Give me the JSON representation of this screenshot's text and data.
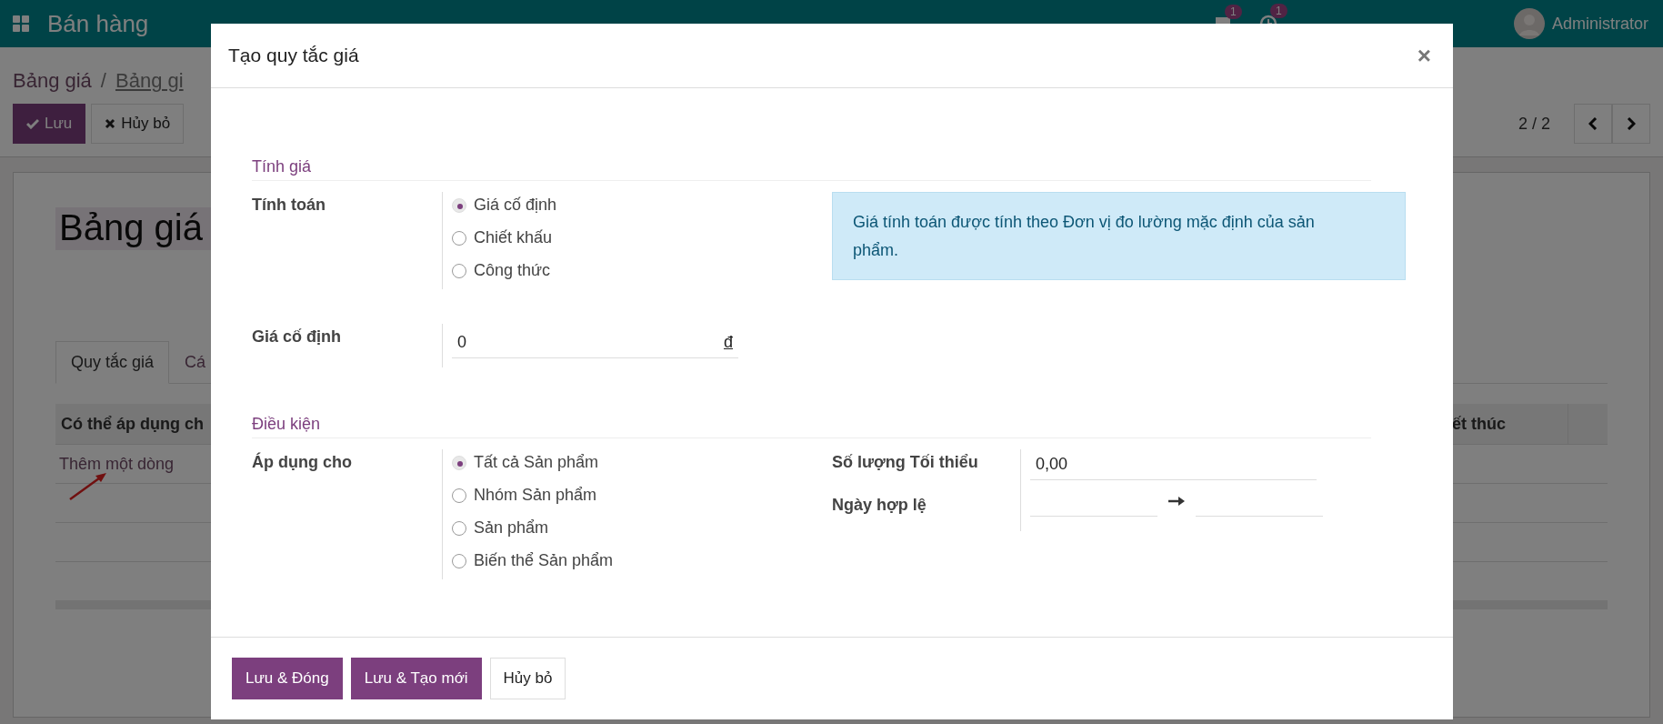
{
  "navbar": {
    "app_title": "Bán hàng",
    "messages_badge": "1",
    "activities_badge": "1",
    "user": "Administrator"
  },
  "breadcrumb": {
    "items": [
      "Bảng giá",
      "Bảng gi"
    ],
    "separator": "/"
  },
  "toolbar": {
    "buttons": [
      {
        "label": "Lưu",
        "kind": "primary"
      },
      {
        "label": "Hủy bỏ",
        "kind": "secondary"
      }
    ],
    "pager": "2 / 2"
  },
  "form": {
    "title": "Bảng giá",
    "tabs": [
      {
        "label": "Quy tắc giá",
        "selected": true
      },
      {
        "label": "Cá",
        "selected": false
      }
    ],
    "table": {
      "columns": [
        "Có thể áp dụng ch",
        "ết thúc"
      ],
      "add_line": "Thêm một dòng"
    }
  },
  "dialog": {
    "title": "Tạo quy tắc giá",
    "close": "×",
    "compute": {
      "section": "Tính giá",
      "label": "Tính toán",
      "options": [
        {
          "label": "Giá cố định",
          "selected": true
        },
        {
          "label": "Chiết khấu",
          "selected": false
        },
        {
          "label": "Công thức",
          "selected": false
        }
      ],
      "note": "Giá tính toán được tính theo Đơn vị đo lường mặc định của sản phẩm."
    },
    "fixed_price": {
      "label": "Giá cố định",
      "value": "0",
      "currency": "đ"
    },
    "conditions": {
      "section": "Điều kiện",
      "label": "Áp dụng cho",
      "options": [
        {
          "label": "Tất cả Sản phẩm",
          "selected": true
        },
        {
          "label": "Nhóm Sản phẩm",
          "selected": false
        },
        {
          "label": "Sản phẩm",
          "selected": false
        },
        {
          "label": "Biến thể Sản phẩm",
          "selected": false
        }
      ],
      "min_qty": {
        "label": "Số lượng Tối thiểu",
        "value": "0,00"
      },
      "validity": {
        "label": "Ngày hợp lệ"
      }
    },
    "footer_buttons": [
      {
        "label": "Lưu & Đóng",
        "kind": "primary"
      },
      {
        "label": "Lưu & Tạo mới",
        "kind": "primary"
      },
      {
        "label": "Hủy bỏ",
        "kind": "secondary"
      }
    ]
  }
}
